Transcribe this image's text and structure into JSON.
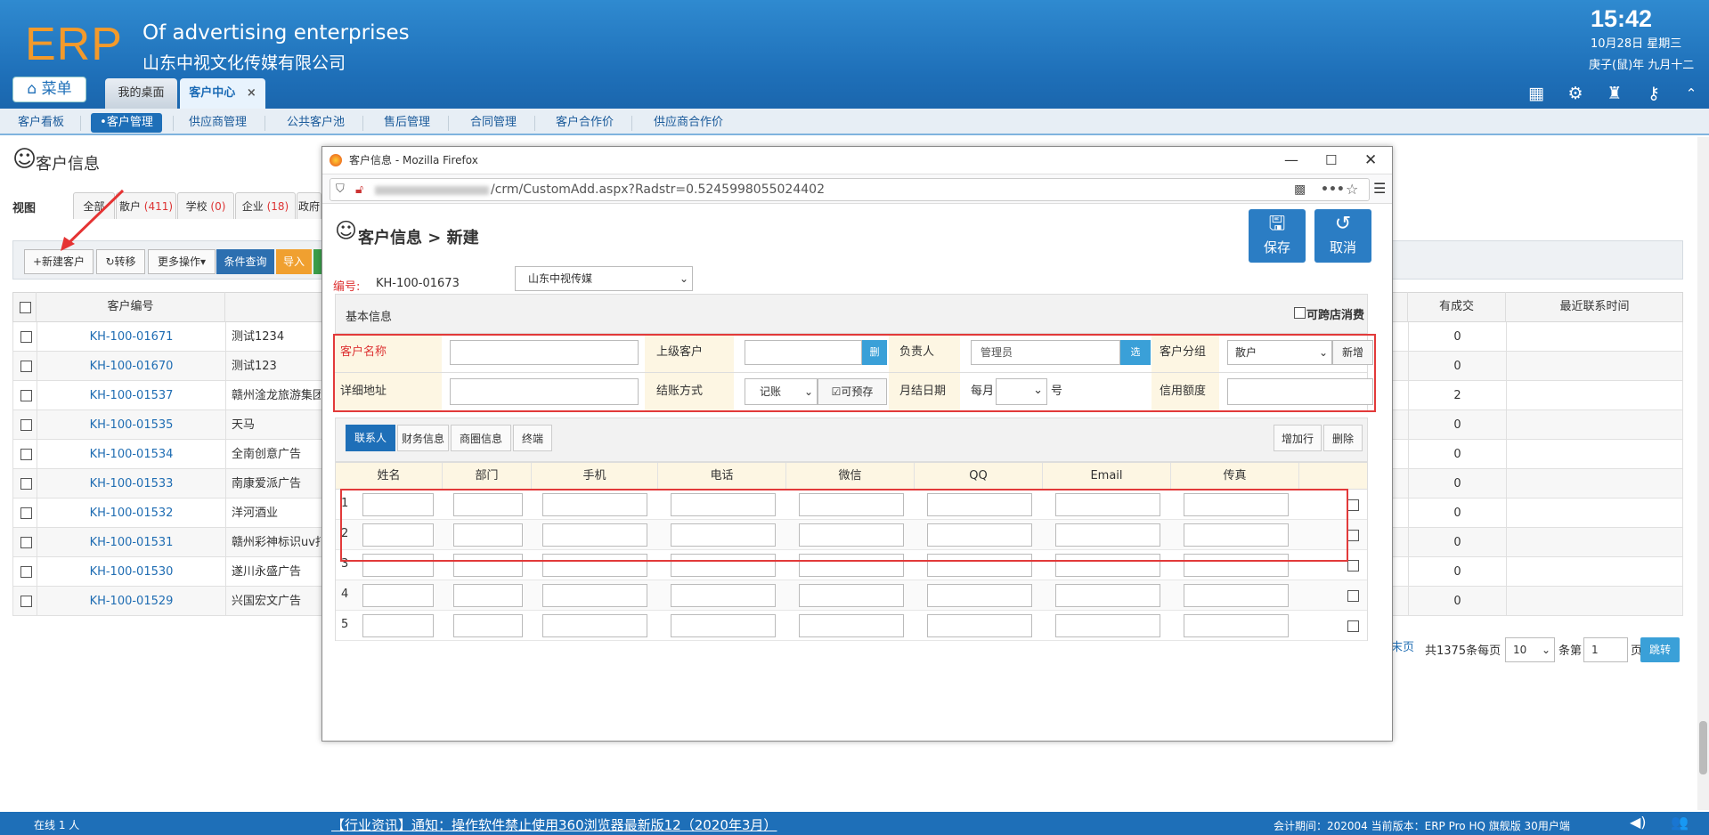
{
  "app": {
    "logo": "ERP",
    "subtitle_en": "Of advertising enterprises",
    "company": "山东中视文化传媒有限公司",
    "time": "15:42",
    "date": "10月28日 星期三",
    "lunar": "庚子(鼠)年 九月十二",
    "menu_label": "菜单"
  },
  "tabs": [
    {
      "label": "我的桌面"
    },
    {
      "label": "客户中心"
    }
  ],
  "tab_close": "×",
  "nav": [
    "客户看板",
    "•客户管理",
    "供应商管理",
    "公共客户池",
    "售后管理",
    "合同管理",
    "客户合作价",
    "供应商合作价"
  ],
  "page": {
    "title": "客户信息",
    "view_label": "视图",
    "view_tabs": [
      {
        "label": "全部"
      },
      {
        "label": "散户",
        "count": "(411)"
      },
      {
        "label": "学校",
        "count": "(0)"
      },
      {
        "label": "企业",
        "count": "(18)"
      },
      {
        "label": "政府"
      }
    ],
    "toolbar": {
      "new": "+新建客户",
      "transfer": "转移",
      "more": "更多操作▾",
      "query": "条件查询",
      "import": "导入"
    },
    "columns": {
      "id": "客户编号",
      "deals": "有成交",
      "last_contact": "最近联系时间"
    },
    "rows": [
      {
        "id": "KH-100-01671",
        "name": "测试1234",
        "deals": "0"
      },
      {
        "id": "KH-100-01670",
        "name": "测试123",
        "deals": "0"
      },
      {
        "id": "KH-100-01537",
        "name": "赣州淦龙旅游集团",
        "deals": "2"
      },
      {
        "id": "KH-100-01535",
        "name": "天马",
        "deals": "0"
      },
      {
        "id": "KH-100-01534",
        "name": "全南创意广告",
        "deals": "0"
      },
      {
        "id": "KH-100-01533",
        "name": "南康爱派广告",
        "deals": "0"
      },
      {
        "id": "KH-100-01532",
        "name": "洋河酒业",
        "deals": "0"
      },
      {
        "id": "KH-100-01531",
        "name": "赣州彩神标识uv打",
        "deals": "0"
      },
      {
        "id": "KH-100-01530",
        "name": "遂川永盛广告",
        "deals": "0"
      },
      {
        "id": "KH-100-01529",
        "name": "兴国宏文广告",
        "deals": "0"
      }
    ],
    "pager": {
      "last": "末页",
      "total": "共1375条每页",
      "per_page": "10",
      "page_label": "条第",
      "page": "1",
      "page_unit": "页",
      "go": "跳转"
    }
  },
  "footer": {
    "online": "在线  1  人",
    "notice": "【行业资讯】通知：操作软件禁止使用360浏览器最新版12（2020年3月）",
    "version": "会计期间：202004  当前版本：ERP Pro HQ 旗舰版 30用户端"
  },
  "popup": {
    "window_title": "客户信息 - Mozilla Firefox",
    "url": "/crm/CustomAdd.aspx?Radstr=0.5245998055024402",
    "heading": "客户信息 > 新建",
    "save": "保存",
    "cancel": "取消",
    "code_label": "编号:",
    "code": "KH-100-01673",
    "company_select": "山东中视传媒",
    "basic_info": "基本信息",
    "cross_store": "可跨店消费",
    "form": {
      "customer_name": "客户名称",
      "parent_customer": "上级客户",
      "delete_btn": "删",
      "owner": "负责人",
      "owner_value": "管理员",
      "select_btn": "选",
      "group": "客户分组",
      "group_value": "散户",
      "add_btn": "新增",
      "address": "详细地址",
      "settlement": "结账方式",
      "settlement_value": "记账",
      "prestore": "可预存",
      "monthly_date": "月结日期",
      "every_month": "每月",
      "day_unit": "号",
      "credit": "信用额度"
    },
    "subtabs": [
      "联系人",
      "财务信息",
      "商圈信息",
      "终端"
    ],
    "add_row": "增加行",
    "delete_row": "删除",
    "contact_cols": [
      "姓名",
      "部门",
      "手机",
      "电话",
      "微信",
      "QQ",
      "Email",
      "传真"
    ],
    "row_numbers": [
      "1",
      "2",
      "3",
      "4",
      "5"
    ]
  }
}
